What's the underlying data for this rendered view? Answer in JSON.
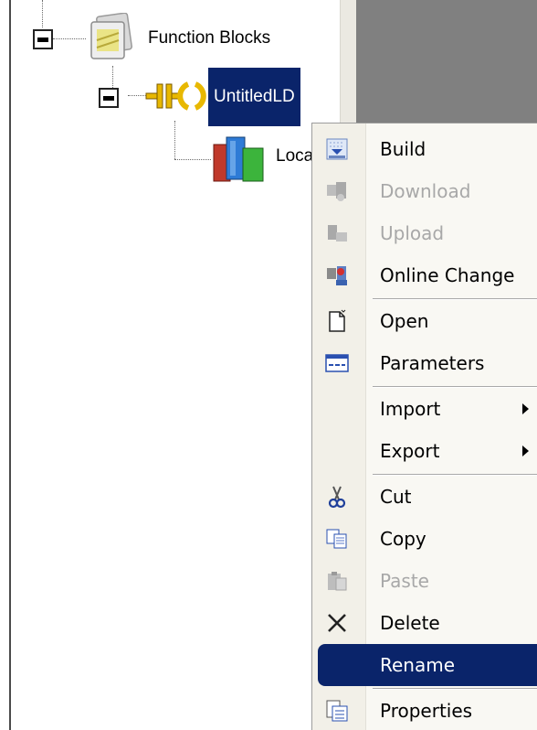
{
  "tree": {
    "function_blocks": {
      "label": "Function Blocks",
      "icon": "function-blocks-folder-icon"
    },
    "untitled_ld": {
      "label": "UntitledLD",
      "icon": "ladder-diagram-icon",
      "selected": true
    },
    "local": {
      "label": "Loca",
      "icon": "local-variables-books-icon"
    }
  },
  "context_menu": {
    "items": [
      {
        "label": "Build",
        "icon": "build-icon",
        "enabled": true
      },
      {
        "label": "Download",
        "icon": "download-icon",
        "enabled": false
      },
      {
        "label": "Upload",
        "icon": "upload-icon",
        "enabled": false
      },
      {
        "label": "Online Change",
        "icon": "online-change-icon",
        "enabled": true
      },
      {
        "label": "Open",
        "icon": "open-document-icon",
        "enabled": true
      },
      {
        "label": "Parameters",
        "icon": "parameters-icon",
        "enabled": true
      },
      {
        "label": "Import",
        "icon": "",
        "enabled": true,
        "submenu": true
      },
      {
        "label": "Export",
        "icon": "",
        "enabled": true,
        "submenu": true
      },
      {
        "label": "Cut",
        "icon": "scissors-icon",
        "enabled": true
      },
      {
        "label": "Copy",
        "icon": "copy-icon",
        "enabled": true
      },
      {
        "label": "Paste",
        "icon": "paste-icon",
        "enabled": false
      },
      {
        "label": "Delete",
        "icon": "delete-x-icon",
        "enabled": true
      },
      {
        "label": "Rename",
        "icon": "",
        "enabled": true,
        "highlighted": true
      },
      {
        "label": "Properties",
        "icon": "properties-icon",
        "enabled": true
      }
    ]
  },
  "colors": {
    "selection": "#0a246a",
    "menu_background": "#f9f8f3",
    "disabled_text": "#a8a8a8",
    "right_panel": "#808080"
  }
}
